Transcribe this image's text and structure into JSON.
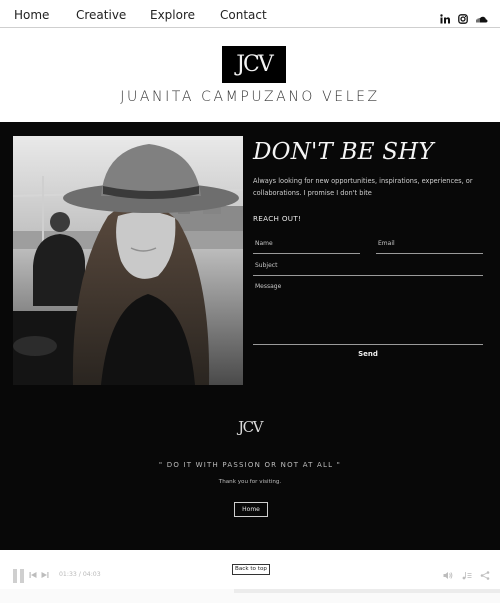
{
  "nav": {
    "items": [
      {
        "label": "Home"
      },
      {
        "label": "Creative"
      },
      {
        "label": "Explore"
      },
      {
        "label": "Contact"
      }
    ],
    "social": [
      "linkedin-icon",
      "instagram-icon",
      "soundcloud-icon"
    ]
  },
  "header": {
    "logo": "JCV",
    "site_name": "JUANITA CAMPUZANO VELEZ"
  },
  "contact": {
    "title": "DON'T BE SHY",
    "intro": "Always looking for new opportunities, inspirations, experiences, or collaborations. I promise I don't bite",
    "reach_out": "REACH OUT!",
    "fields": {
      "name": "Name",
      "email": "Email",
      "subject": "Subject",
      "message": "Message"
    },
    "send_label": "Send"
  },
  "footer": {
    "logo": "JCV",
    "quote": "\" DO IT WITH PASSION OR NOT AT ALL \"",
    "thanks": "Thank you for visiting.",
    "home_label": "Home",
    "back_to_top": "Back to top"
  },
  "player": {
    "time": "01:33 / 04:03"
  },
  "colors": {
    "dark_bg": "#080808",
    "accent_text": "#f5f5f5",
    "muted": "#bdbdbd"
  }
}
